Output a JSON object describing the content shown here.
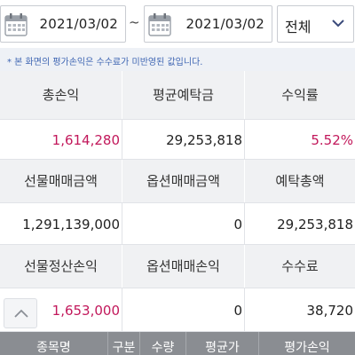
{
  "filter": {
    "date_from": "2021/03/02",
    "separator": "~",
    "date_to": "2021/03/02",
    "period_select": "전체"
  },
  "notice": "* 본 화면의 평가손익은 수수료가 미반영된 값입니다.",
  "summary": {
    "row1_headers": [
      "총손익",
      "평균예탁금",
      "수익률"
    ],
    "row1_values": [
      "1,614,280",
      "29,253,818",
      "5.52%"
    ],
    "row2_headers": [
      "선물매매금액",
      "옵션매매금액",
      "예탁총액"
    ],
    "row2_values": [
      "1,291,139,000",
      "0",
      "29,253,818"
    ],
    "row3_headers": [
      "선물정산손익",
      "옵션매매손익",
      "수수료"
    ],
    "row3_values": [
      "1,653,000",
      "0",
      "38,720"
    ]
  },
  "table_headers": [
    "종목명",
    "구분",
    "수량",
    "평균가",
    "평가손익"
  ],
  "colors": {
    "accent_pink": "#c2185b",
    "notice_blue": "#3f66b3",
    "header_bg": "#f0f1f3",
    "table_header_bg": "#8a8d92"
  },
  "icons": [
    "calendar-icon",
    "chevron-down-icon",
    "chevron-up-icon"
  ]
}
